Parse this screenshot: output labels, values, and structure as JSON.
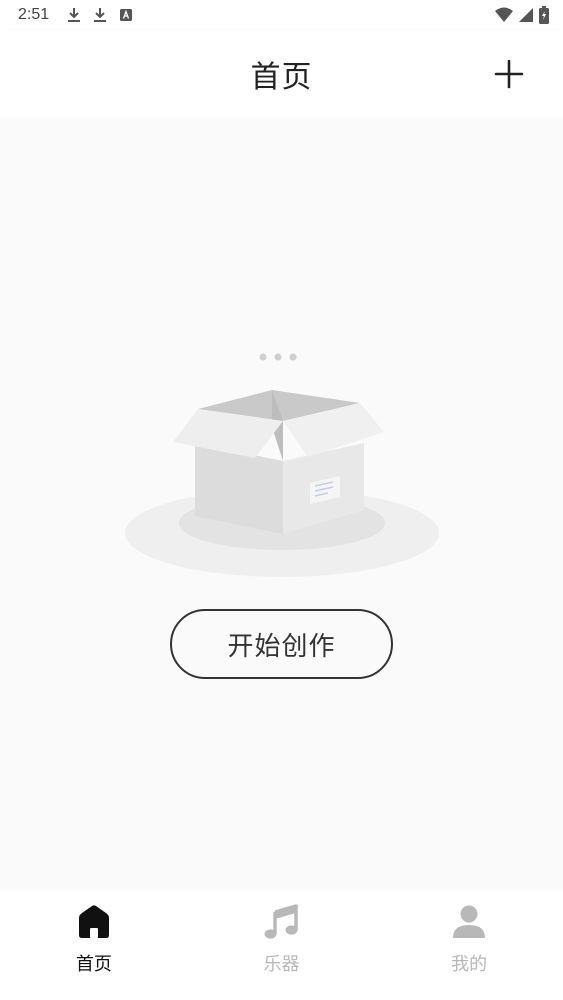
{
  "status_bar": {
    "time": "2:51",
    "left_icons": [
      "download-icon",
      "download-icon",
      "a-box-icon"
    ],
    "right_icons": [
      "wifi-icon",
      "cell-signal-icon",
      "battery-charging-icon"
    ]
  },
  "header": {
    "title": "首页",
    "add_icon": "plus-icon"
  },
  "empty_state": {
    "illustration": "empty-box-icon",
    "button_label": "开始创作"
  },
  "bottom_nav": {
    "items": [
      {
        "label": "首页",
        "icon": "home-icon",
        "active": true
      },
      {
        "label": "乐器",
        "icon": "music-note-icon",
        "active": false
      },
      {
        "label": "我的",
        "icon": "person-icon",
        "active": false
      }
    ]
  },
  "colors": {
    "active": "#111111",
    "inactive": "#b8b8b8",
    "background": "#fafafa",
    "surface": "#ffffff"
  }
}
